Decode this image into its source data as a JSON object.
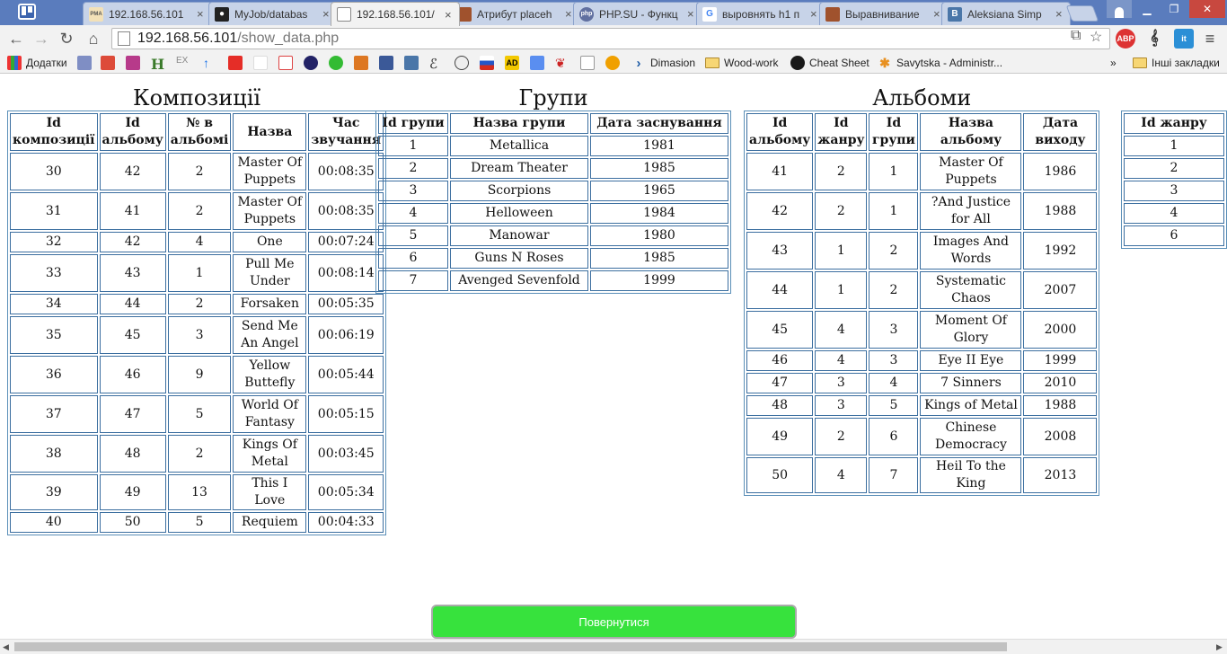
{
  "tabs": [
    {
      "title": "192.168.56.101",
      "favicon": "pma-icon",
      "color": "#f0a030",
      "glyph": "PMA"
    },
    {
      "title": "MyJob/databas",
      "favicon": "github-icon",
      "color": "#222222",
      "glyph": "●"
    },
    {
      "title": "192.168.56.101/",
      "favicon": "page-icon",
      "color": "#999999",
      "glyph": ""
    },
    {
      "title": "Атрибут placeh",
      "favicon": "brick-icon",
      "color": "#a0522d",
      "glyph": ""
    },
    {
      "title": "PHP.SU - Функц",
      "favicon": "php-icon",
      "color": "#6170a0",
      "glyph": "php"
    },
    {
      "title": "выровнять h1 п",
      "favicon": "google-icon",
      "color": "#4285f4",
      "glyph": "G"
    },
    {
      "title": "Выравнивание",
      "favicon": "brick-icon",
      "color": "#a0522d",
      "glyph": ""
    },
    {
      "title": "Aleksiana Simp",
      "favicon": "vk-icon",
      "color": "#4a76a8",
      "glyph": "B"
    }
  ],
  "active_tab": 2,
  "address": {
    "host": "192.168.56.101",
    "path": "/show_data.php"
  },
  "bookmarks": {
    "apps_label": "Додатки",
    "items": [
      "Dimasion",
      "Wood-work",
      "Cheat Sheet",
      "Savytska - Administr..."
    ],
    "more": "»",
    "other_label": "Інші закладки"
  },
  "compositions": {
    "title": "Композиції",
    "headers": [
      "Id композиції",
      "Id альбому",
      "№ в альбомі",
      "Назва",
      "Час звучання"
    ],
    "rows": [
      [
        "30",
        "42",
        "2",
        "Master Of Puppets",
        "00:08:35"
      ],
      [
        "31",
        "41",
        "2",
        "Master Of Puppets",
        "00:08:35"
      ],
      [
        "32",
        "42",
        "4",
        "One",
        "00:07:24"
      ],
      [
        "33",
        "43",
        "1",
        "Pull Me Under",
        "00:08:14"
      ],
      [
        "34",
        "44",
        "2",
        "Forsaken",
        "00:05:35"
      ],
      [
        "35",
        "45",
        "3",
        "Send Me An Angel",
        "00:06:19"
      ],
      [
        "36",
        "46",
        "9",
        "Yellow Buttefly",
        "00:05:44"
      ],
      [
        "37",
        "47",
        "5",
        "World Of Fantasy",
        "00:05:15"
      ],
      [
        "38",
        "48",
        "2",
        "Kings Of Metal",
        "00:03:45"
      ],
      [
        "39",
        "49",
        "13",
        "This I Love",
        "00:05:34"
      ],
      [
        "40",
        "50",
        "5",
        "Requiem",
        "00:04:33"
      ]
    ]
  },
  "groups": {
    "title": "Групи",
    "headers": [
      "Id групи",
      "Назва групи",
      "Дата заснування"
    ],
    "rows": [
      [
        "1",
        "Metallica",
        "1981"
      ],
      [
        "2",
        "Dream Theater",
        "1985"
      ],
      [
        "3",
        "Scorpions",
        "1965"
      ],
      [
        "4",
        "Helloween",
        "1984"
      ],
      [
        "5",
        "Manowar",
        "1980"
      ],
      [
        "6",
        "Guns N Roses",
        "1985"
      ],
      [
        "7",
        "Avenged Sevenfold",
        "1999"
      ]
    ]
  },
  "albums": {
    "title": "Альбоми",
    "headers": [
      "Id альбому",
      "Id жанру",
      "Id групи",
      "Назва альбому",
      "Дата виходу"
    ],
    "rows": [
      [
        "41",
        "2",
        "1",
        "Master Of Puppets",
        "1986"
      ],
      [
        "42",
        "2",
        "1",
        "?And Justice for All",
        "1988"
      ],
      [
        "43",
        "1",
        "2",
        "Images And Words",
        "1992"
      ],
      [
        "44",
        "1",
        "2",
        "Systematic Chaos",
        "2007"
      ],
      [
        "45",
        "4",
        "3",
        "Moment Of Glory",
        "2000"
      ],
      [
        "46",
        "4",
        "3",
        "Eye II Eye",
        "1999"
      ],
      [
        "47",
        "3",
        "4",
        "7 Sinners",
        "2010"
      ],
      [
        "48",
        "3",
        "5",
        "Kings of Metal",
        "1988"
      ],
      [
        "49",
        "2",
        "6",
        "Chinese Democracy",
        "2008"
      ],
      [
        "50",
        "4",
        "7",
        "Heil To the King",
        "2013"
      ]
    ]
  },
  "genres": {
    "headers": [
      "Id жанру"
    ],
    "rows": [
      [
        "1"
      ],
      [
        "2"
      ],
      [
        "3"
      ],
      [
        "4"
      ],
      [
        "6"
      ]
    ]
  },
  "return_button": "Повернутися",
  "colors": {
    "button": "#37e23d",
    "tab_strip": "#5a7cbd",
    "table_border": "#3c6fa0"
  }
}
